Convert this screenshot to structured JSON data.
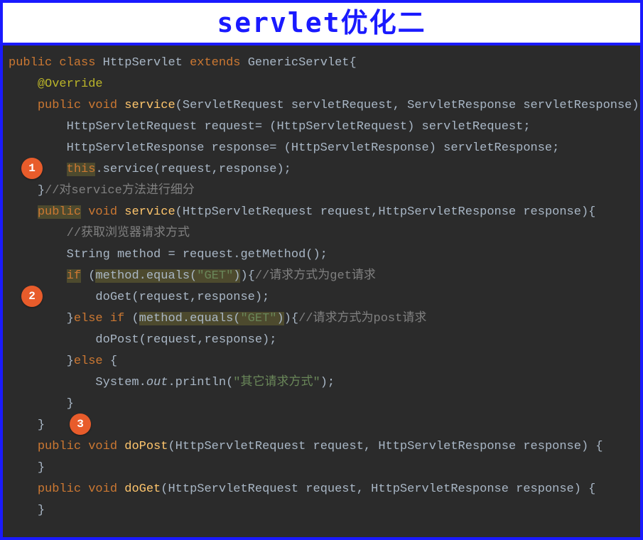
{
  "title": "servlet优化二",
  "badges": {
    "b1": "1",
    "b2": "2",
    "b3": "3"
  },
  "code": {
    "l1": {
      "kw1": "public",
      "kw2": "class",
      "cls": "HttpServlet",
      "kw3": "extends",
      "sup": "GenericServlet",
      "brace": "{"
    },
    "l2": {
      "ann": "@Override"
    },
    "l3": {
      "kw1": "public",
      "kw2": "void",
      "fn": "service",
      "params": "(ServletRequest servletRequest, ServletResponse servletResponse)"
    },
    "l4": {
      "txt": "HttpServletRequest request= (HttpServletRequest) servletRequest;"
    },
    "l5": {
      "txt": "HttpServletResponse response= (HttpServletResponse) servletResponse;"
    },
    "l6": {
      "kw": "this",
      "txt": ".service(request,response);"
    },
    "l7": {
      "brace": "}",
      "cmt": "//对service方法进行细分"
    },
    "l8": {
      "kw1": "public",
      "kw2": "void",
      "fn": "service",
      "params": "(HttpServletRequest request,HttpServletResponse response){"
    },
    "l9": {
      "cmt": "//获取浏览器请求方式"
    },
    "l10": {
      "txt": "String method = request.getMethod();"
    },
    "l11": {
      "kw": "if",
      "op": " (",
      "m": "method.equals(",
      "s": "\"GET\"",
      "cl": ")",
      "close": "){",
      "cmt": "//请求方式为get请求"
    },
    "l12": {
      "txt": "doGet(request,response);"
    },
    "l13": {
      "brace": "}",
      "kw": "else if",
      "op": " (",
      "m": "method.equals(",
      "s": "\"GET\"",
      "cl": ")",
      "close": "){",
      "cmt": "//请求方式为post请求"
    },
    "l14": {
      "txt": "doPost(request,response);"
    },
    "l15": {
      "brace": "}",
      "kw": "else",
      "close": " {"
    },
    "l16": {
      "txt1": "System.",
      "out": "out",
      "txt2": ".println(",
      "s": "\"其它请求方式\"",
      "txt3": ");"
    },
    "l17": {
      "brace": "}"
    },
    "l18": {
      "brace": "}"
    },
    "l19": {
      "kw1": "public",
      "kw2": "void",
      "fn": "doPost",
      "params": "(HttpServletRequest request, HttpServletResponse response) {"
    },
    "l20": {
      "brace": "}"
    },
    "l21": {
      "kw1": "public",
      "kw2": "void",
      "fn": "doGet",
      "params": "(HttpServletRequest request, HttpServletResponse response) {"
    },
    "l22": {
      "brace": "}"
    }
  }
}
